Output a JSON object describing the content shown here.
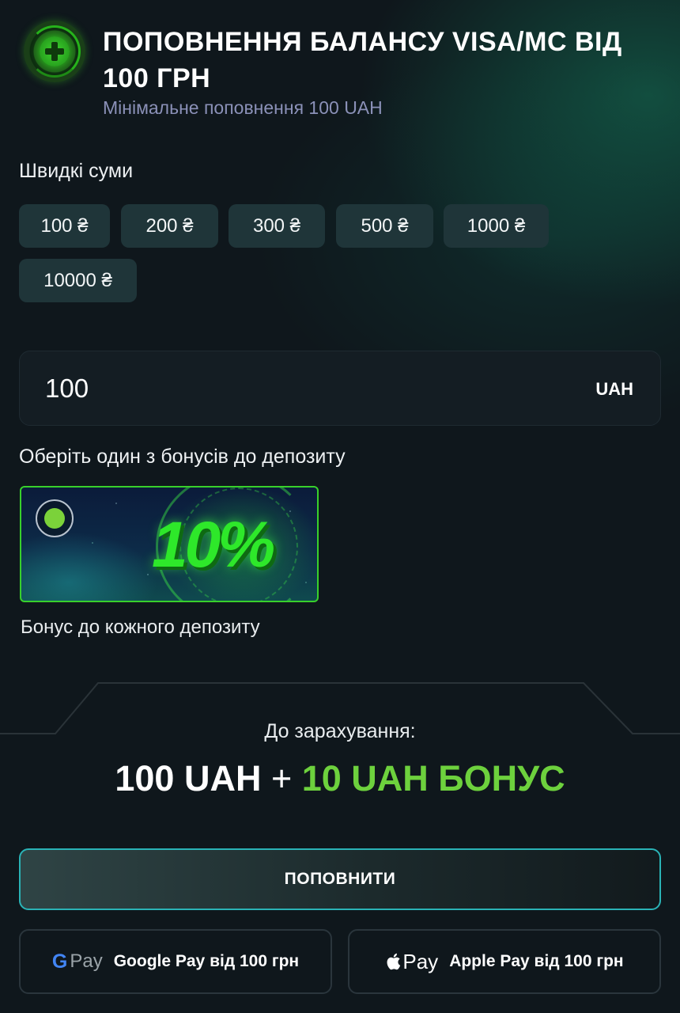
{
  "header": {
    "title": "ПОПОВНЕННЯ БАЛАНСУ VISA/MC ВІД 100 ГРН",
    "subtitle": "Мінімальне поповнення 100 UAH",
    "icon": "plus-circle-icon"
  },
  "quick_sums": {
    "label": "Швидкі суми",
    "items": [
      "100 ₴",
      "200 ₴",
      "300 ₴",
      "500 ₴",
      "1000 ₴",
      "10000 ₴"
    ]
  },
  "amount": {
    "value": "100",
    "currency": "UAH"
  },
  "bonus": {
    "label": "Оберіть один з бонусів до депозиту",
    "card_text": "10%",
    "selected": true,
    "caption": "Бонус до кожного депозиту"
  },
  "summary": {
    "label": "До зарахування:",
    "base": "100 UAH",
    "plus": "+",
    "bonus": "10 UAH БОНУС"
  },
  "actions": {
    "submit_label": "ПОПОВНИТИ",
    "google_pay_label": "Google Pay від 100 грн",
    "apple_pay_label": "Apple Pay від 100 грн",
    "google_pay_logo": "Pay",
    "apple_pay_logo": "Pay"
  },
  "colors": {
    "background": "#0f171c",
    "accent_green": "#6dd13d",
    "chip_bg": "#1f3539",
    "submit_border": "#2ab3b6",
    "subtitle": "#8b91b8"
  }
}
